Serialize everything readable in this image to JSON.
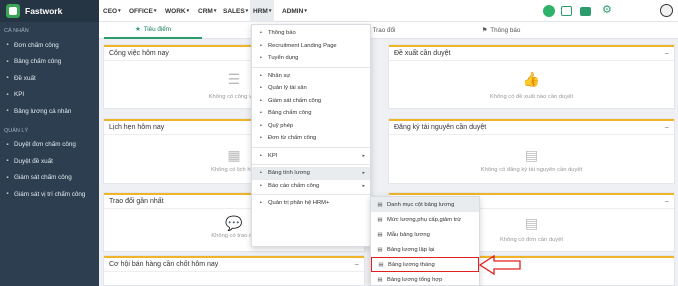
{
  "app": {
    "name": "Fastwork"
  },
  "sidebar": {
    "section1": "CÁ NHÂN",
    "items1": [
      {
        "label": "Đơn chấm công",
        "icon": "document-icon"
      },
      {
        "label": "Bảng chấm công",
        "icon": "table-icon"
      },
      {
        "label": "Đề xuất",
        "icon": "edit-icon"
      },
      {
        "label": "KPI",
        "icon": "target-icon"
      },
      {
        "label": "Bảng lương cá nhân",
        "icon": "money-icon"
      }
    ],
    "section2": "QUẢN LÝ",
    "items2": [
      {
        "label": "Duyệt đơn chấm công",
        "icon": "check-icon"
      },
      {
        "label": "Duyệt đề xuất",
        "icon": "check-circle-icon"
      },
      {
        "label": "Giám sát chấm công",
        "icon": "calendar-icon"
      },
      {
        "label": "Giám sát vị trí chấm công",
        "icon": "location-icon"
      }
    ]
  },
  "topnav": {
    "items": [
      "CEO",
      "OFFICE",
      "WORK",
      "CRM",
      "SALES",
      "HRM",
      "ADMIN"
    ],
    "active": "HRM"
  },
  "tabs": [
    "Tiêu điểm",
    "Trao đổi",
    "Thông báo"
  ],
  "cards": [
    {
      "title": "Công việc hôm nay",
      "empty": "Không có công việc"
    },
    {
      "title": "Đề xuất cần duyệt",
      "empty": "Không có đề xuất nào cần duyệt"
    },
    {
      "title": "Lịch hẹn hôm nay",
      "empty": "Không có lịch hẹn"
    },
    {
      "title": "Đăng ký tài nguyên cần duyệt",
      "empty": "Không có đăng ký tài nguyên cần duyệt"
    },
    {
      "title": "Trao đổi gần nhất",
      "empty": "Không có trao đổi"
    },
    {
      "title": "",
      "empty": "Không có đơn cần duyệt"
    },
    {
      "title": "Cơ hội bán hàng cần chốt hôm nay",
      "empty": ""
    }
  ],
  "hrm_menu": [
    {
      "label": "Thông báo",
      "icon": "bell-icon"
    },
    {
      "label": "Recruitment Landing Page",
      "icon": "page-icon"
    },
    {
      "label": "Tuyển dụng",
      "icon": "megaphone-icon"
    },
    {
      "sep": true
    },
    {
      "label": "Nhân sự",
      "icon": "user-icon"
    },
    {
      "label": "Quản lý tài sản",
      "icon": "box-icon"
    },
    {
      "label": "Giám sát chấm công",
      "icon": "monitor-icon"
    },
    {
      "label": "Bảng chấm công",
      "icon": "table-icon"
    },
    {
      "label": "Quỹ phép",
      "icon": "folder-icon"
    },
    {
      "label": "Đơn từ chấm công",
      "icon": "document-icon"
    },
    {
      "sep": true
    },
    {
      "label": "KPI",
      "icon": "target-icon",
      "arrow": true
    },
    {
      "sep": true
    },
    {
      "label": "Bảng tính lương",
      "icon": "calculator-icon",
      "arrow": true,
      "selected": true
    },
    {
      "label": "Báo cáo chấm công",
      "icon": "chart-icon",
      "arrow": true
    },
    {
      "sep": true
    },
    {
      "label": "Quản trị phân hệ HRM+",
      "icon": "gear-icon"
    }
  ],
  "payroll_submenu": [
    {
      "label": "Danh mục cột bảng lương",
      "selected": true
    },
    {
      "label": "Mức lương,phụ cấp,giảm trừ"
    },
    {
      "label": "Mẫu bảng lương"
    },
    {
      "label": "Bảng lương lập lại"
    },
    {
      "label": "Bảng lương tháng",
      "highlight": true
    },
    {
      "label": "Bảng lương tổng hợp"
    }
  ],
  "colors": {
    "annotation": "#e02020",
    "accent": "#2d9c6c",
    "card_top": "#f0b429",
    "sidebar": "#2c3e50"
  }
}
